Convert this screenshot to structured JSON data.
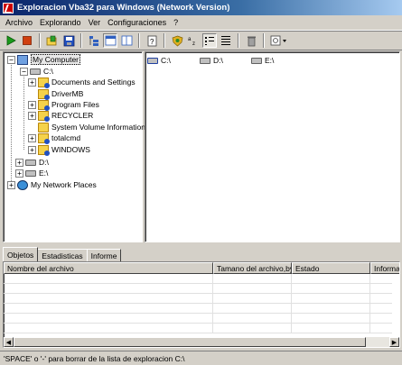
{
  "window": {
    "title": "Exploracion Vba32 para Windows (Network Version)"
  },
  "menu": [
    {
      "label": "Archivo"
    },
    {
      "label": "Explorando"
    },
    {
      "label": "Ver"
    },
    {
      "label": "Configuraciones"
    },
    {
      "label": "?"
    }
  ],
  "toolbar": {
    "buttons": [
      "play-icon",
      "stop-icon",
      "open-icon",
      "save-icon",
      "tree-view-icon",
      "list-view-icon",
      "detail-view-icon",
      "report-icon",
      "shield-icon",
      "sort-icon",
      "list-icon",
      "details-icon",
      "trash-icon",
      "options-icon"
    ],
    "colors": {
      "play": "#1a9a1a",
      "stop": "#d04010",
      "accent": "#0a246a"
    }
  },
  "tree": {
    "root": "My Computer",
    "drive_c": "C:\\",
    "folders": [
      "Documents and Settings",
      "DriverMB",
      "Program Files",
      "RECYCLER",
      "System Volume Information",
      "totalcmd",
      "WINDOWS"
    ],
    "drive_d": "D:\\",
    "drive_e": "E:\\",
    "network": "My Network Places"
  },
  "drives": [
    {
      "label": "C:\\"
    },
    {
      "label": "D:\\"
    },
    {
      "label": "E:\\"
    }
  ],
  "tabs": [
    {
      "label": "Objetos"
    },
    {
      "label": "Estadisticas"
    },
    {
      "label": "Informe"
    }
  ],
  "table": {
    "columns": [
      "Nombre del archivo",
      "Tamano del archivo,bytes",
      "Estado",
      "Informac"
    ]
  },
  "status": {
    "text": "'SPACE' o '-' para borrar de la lista de exploracion C:\\"
  }
}
